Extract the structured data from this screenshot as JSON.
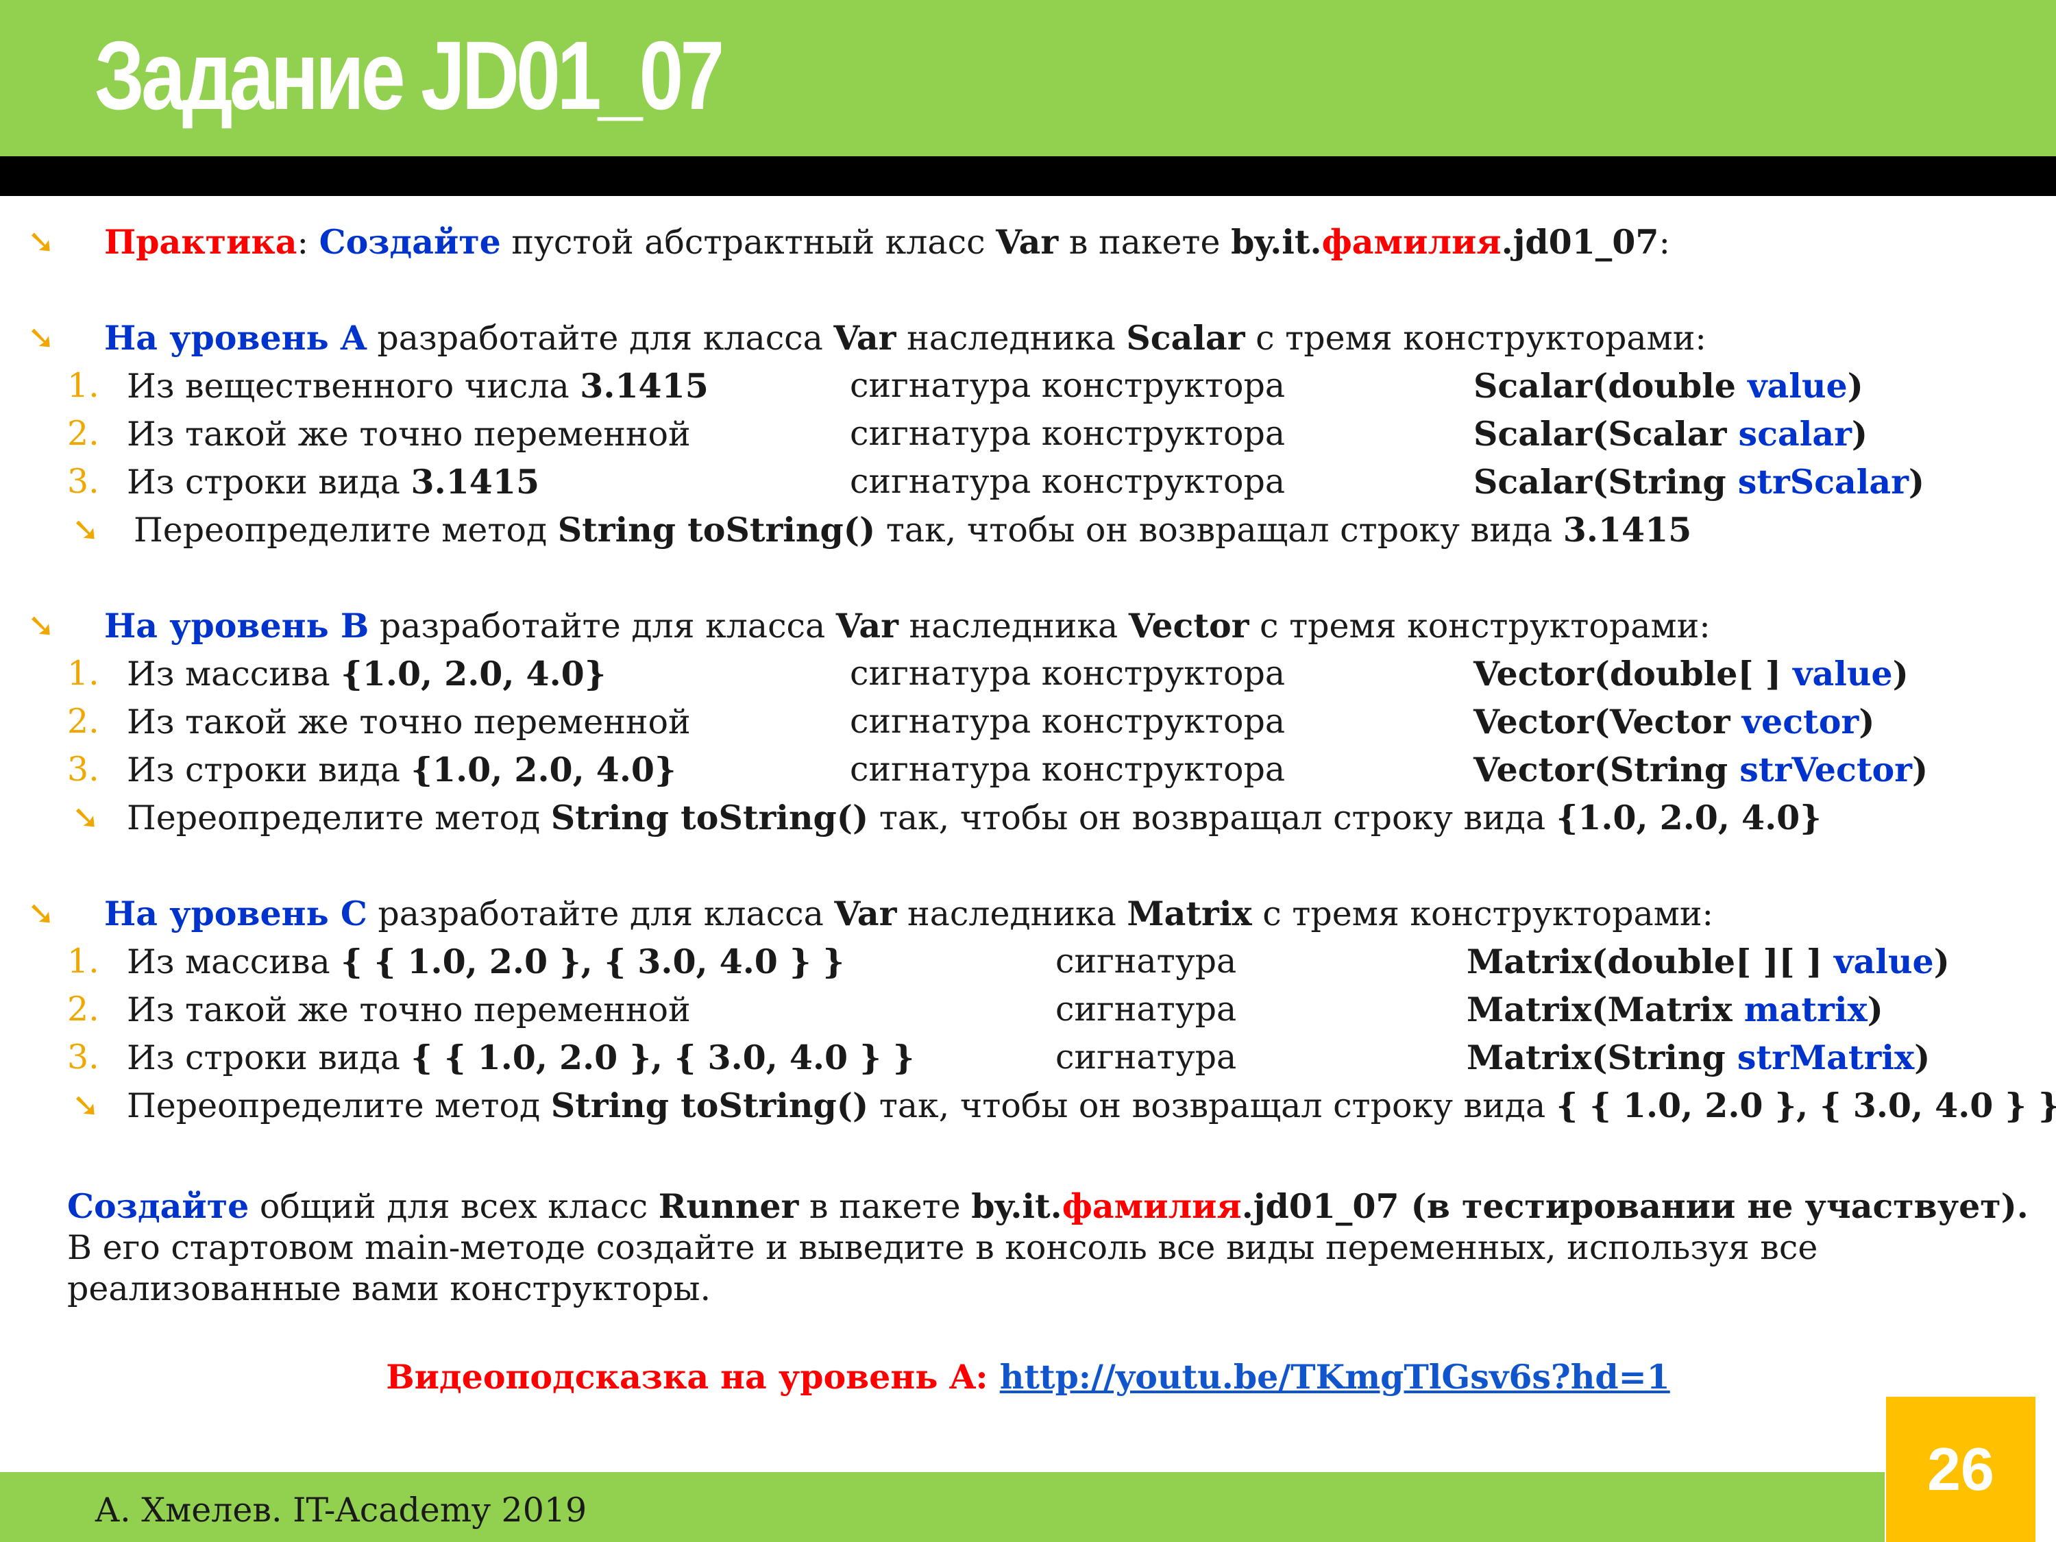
{
  "title": "Задание JD01_07",
  "intro": {
    "practice_label": "Практика",
    "colon": ": ",
    "create_label": "Создайте",
    "text1": " пустой абстрактный класс ",
    "class_name": "Var",
    "text2": " в пакете ",
    "pkg_prefix": "by.it.",
    "pkg_family": "фамилия",
    "pkg_suffix": ".jd01_07",
    "end": ":"
  },
  "levels": [
    {
      "label": "На уровень A",
      "text1": " разработайте для класса ",
      "base": "Var",
      "text2": " наследника ",
      "subclass": "Scalar",
      "text3": " с тремя конструкторами:",
      "items": [
        {
          "num": "1.",
          "text": "Из вещественного числа ",
          "bold": "3.1415",
          "col2": "сигнатура конструктора",
          "sig_prefix": "Scalar(double ",
          "sig_param": "value",
          "sig_end": ")"
        },
        {
          "num": "2.",
          "text": "Из такой же точно переменной",
          "bold": "",
          "col2": "сигнатура конструктора",
          "sig_prefix": "Scalar(Scalar ",
          "sig_param": "scalar",
          "sig_end": ")"
        },
        {
          "num": "3.",
          "text": "Из строки вида ",
          "bold": "3.1415",
          "col2": "сигнатура конструктора",
          "sig_prefix": "Scalar(String ",
          "sig_param": "strScalar",
          "sig_end": ")"
        }
      ],
      "override": {
        "text1": "Переопределите метод ",
        "method": "String toString()",
        "text2": " так, чтобы он возвращал строку вида ",
        "value": "3.1415"
      }
    },
    {
      "label": "На уровень B",
      "text1": " разработайте для класса ",
      "base": "Var",
      "text2": " наследника ",
      "subclass": "Vector",
      "text3": " с тремя конструкторами:",
      "items": [
        {
          "num": "1.",
          "text": "Из массива ",
          "bold": "{1.0, 2.0, 4.0}",
          "col2": "сигнатура конструктора",
          "sig_prefix": "Vector(double[ ] ",
          "sig_param": "value",
          "sig_end": ")"
        },
        {
          "num": "2.",
          "text": "Из такой же точно переменной",
          "bold": "",
          "col2": "сигнатура конструктора",
          "sig_prefix": "Vector(Vector ",
          "sig_param": "vector",
          "sig_end": ")"
        },
        {
          "num": "3.",
          "text": "Из строки вида  ",
          "bold": "{1.0, 2.0, 4.0}",
          "col2": "сигнатура конструктора",
          "sig_prefix": "Vector(String ",
          "sig_param": "strVector",
          "sig_end": ")"
        }
      ],
      "override": {
        "text1": "Переопределите метод ",
        "method": "String toString()",
        "text2": " так, чтобы он возвращал строку вида ",
        "value": "{1.0, 2.0, 4.0}"
      }
    },
    {
      "label": "На уровень C",
      "text1": " разработайте для класса ",
      "base": "Var",
      "text2": " наследника ",
      "subclass": "Matrix",
      "text3": " с тремя конструкторами:",
      "items": [
        {
          "num": "1.",
          "text": "Из массива ",
          "bold": "{ { 1.0, 2.0 },  { 3.0, 4.0 } }",
          "col2": "сигнатура",
          "sig_prefix": "Matrix(double[ ][ ]  ",
          "sig_param": "value",
          "sig_end": ")"
        },
        {
          "num": "2.",
          "text": "Из такой же точно переменной",
          "bold": "",
          "col2": "сигнатура",
          "sig_prefix": "Matrix(Matrix ",
          "sig_param": "matrix",
          "sig_end": ")"
        },
        {
          "num": "3.",
          "text": "Из строки вида  ",
          "bold": "{ { 1.0, 2.0 },  { 3.0, 4.0 } }",
          "col2": "сигнатура",
          "sig_prefix": "Matrix(String ",
          "sig_param": "strMatrix",
          "sig_end": ")"
        }
      ],
      "override": {
        "text1": "Переопределите метод ",
        "method": "String toString()",
        "text2": " так, чтобы он возвращал строку вида ",
        "value": "{ { 1.0, 2.0 },  { 3.0, 4.0 } }"
      }
    }
  ],
  "runner": {
    "create_label": "Создайте",
    "text1": " общий для всех класс ",
    "class_name": "Runner",
    "text2": " в пакете ",
    "pkg_prefix": "by.it.",
    "pkg_family": "фамилия",
    "pkg_suffix": ".jd01_07 (в тестировании не участвует).",
    "line2": "В его стартовом main-методе создайте и выведите в консоль все виды переменных, используя все",
    "line3": "реализованные вами конструкторы."
  },
  "video": {
    "label": "Видеоподсказка на уровень A: ",
    "link": "http://youtu.be/TKmgTlGsv6s?hd=1"
  },
  "footer": {
    "author": "А. Хмелев. IT-Academy 2019",
    "page": "26"
  },
  "colors": {
    "header_green": "#92d050",
    "bar_black": "#000000",
    "accent_orange": "#ffc000",
    "red": "#ff0000",
    "blue": "#0033cc"
  },
  "icons": {
    "bullet": "arrow-down-right-icon"
  }
}
